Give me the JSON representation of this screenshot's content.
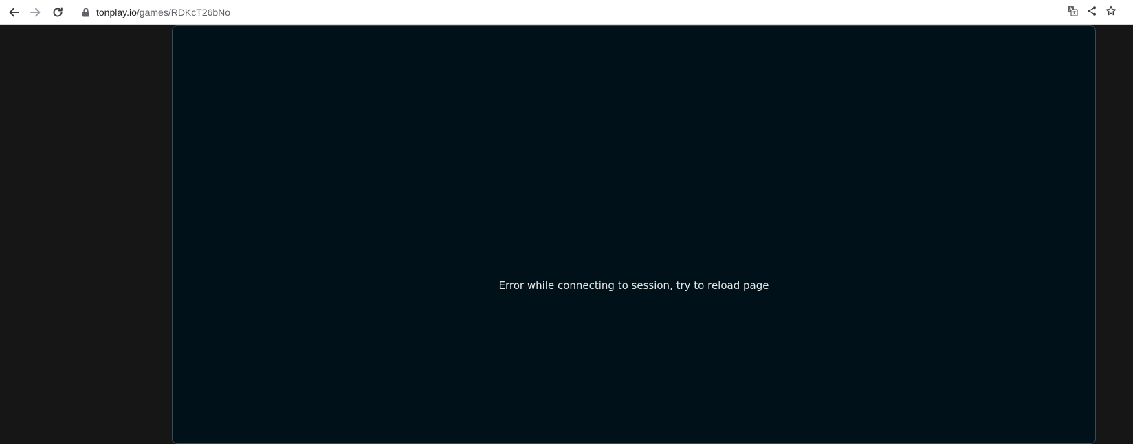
{
  "browser": {
    "url_host": "tonplay.io",
    "url_path": "/games/RDKcT26bNo",
    "icons": {
      "back": "back-arrow-icon",
      "forward": "forward-arrow-icon",
      "reload": "reload-icon",
      "lock": "lock-icon",
      "translate": "translate-icon",
      "share": "share-icon",
      "bookmark": "star-icon"
    }
  },
  "game": {
    "error_message": "Error while connecting to session, try to reload page"
  },
  "colors": {
    "page_background": "#161616",
    "game_background": "#00111a",
    "frame_border": "#3a4a55",
    "error_text": "#e6e6e6"
  }
}
